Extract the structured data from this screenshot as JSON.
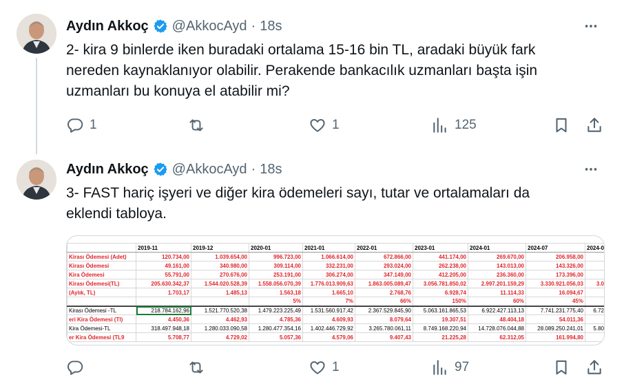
{
  "colors": {
    "text": "#0f1419",
    "secondary": "#536471",
    "verified": "#1d9bf0",
    "sheet_red": "#e0262c"
  },
  "tweets": [
    {
      "author": {
        "name": "Aydın Akkoç",
        "handle": "@AkkocAyd",
        "time": "18s"
      },
      "separator": "·",
      "text": "2- kira 9 binlerde iken buradaki ortalama 15-16 bin TL, aradaki büyük fark\nnereden kaynaklanıyor olabilir. Perakende bankacılık uzmanları başta işin\nuzmanları bu konuya el atabilir mi?",
      "replies": "1",
      "reposts": "",
      "likes": "1",
      "views": "125"
    },
    {
      "author": {
        "name": "Aydın Akkoç",
        "handle": "@AkkocAyd",
        "time": "18s"
      },
      "separator": "·",
      "text": "3- FAST hariç işyeri ve diğer kira ödemeleri sayı, tutar ve ortalamaları da\neklendi tabloya.",
      "replies": "",
      "reposts": "",
      "likes": "1",
      "views": "97"
    }
  ],
  "icons": {
    "reply": "reply-icon",
    "repost": "repost-icon",
    "like": "heart-icon",
    "views": "views-icon",
    "bookmark": "bookmark-icon",
    "share": "share-icon",
    "more": "more-icon",
    "verified": "verified-badge-icon"
  },
  "spreadsheet": {
    "header": [
      "",
      "2019-11",
      "2019-12",
      "2020-01",
      "2021-01",
      "2022-01",
      "2023-01",
      "2024-01",
      "2024-07",
      "2024-0"
    ],
    "rows": [
      [
        "Kirası Ödemesi (Adet)",
        "120.734,00",
        "1.039.654,00",
        "996.723,00",
        "1.066.614,00",
        "672.866,00",
        "441.174,00",
        "269.670,00",
        "206.958,00",
        ""
      ],
      [
        "Kirası Ödemesi",
        "49.161,00",
        "340.980,00",
        "309.114,00",
        "332.231,00",
        "293.024,00",
        "262.238,00",
        "143.013,00",
        "143.326,00",
        ""
      ],
      [
        "Kira Ödemesi",
        "55.791,00",
        "270.676,00",
        "253.191,00",
        "306.274,00",
        "347.149,00",
        "412.205,00",
        "236.360,00",
        "173.396,00",
        ""
      ],
      [
        "Kirası Ödemesi(TL)",
        "205.630.342,37",
        "1.544.020.528,39",
        "1.558.056.070,39",
        "1.776.013.909,63",
        "1.863.005.089,47",
        "3.056.781.850,02",
        "2.997.201.159,29",
        "3.330.921.056,03",
        "3.0"
      ],
      [
        "(Aylık, TL)",
        "1.703,17",
        "1.485,13",
        "1.563,18",
        "1.665,10",
        "2.768,76",
        "6.928,74",
        "11.114,33",
        "16.094,67",
        ""
      ],
      [
        "",
        "",
        "",
        "5%",
        "7%",
        "66%",
        "150%",
        "60%",
        "45%",
        ""
      ],
      [
        "Kirası Ödemesi -TL",
        "218.784.162,96",
        "1.521.770.520,38",
        "1.479.223.225,49",
        "1.531.560.917,42",
        "2.367.529.845,90",
        "5.063.161.865,53",
        "6.922.427.113,13",
        "7.741.231.775,40",
        "6.72"
      ],
      [
        "eri Kira Ödemesi (Tl)",
        "4.450,36",
        "4.462,93",
        "4.785,36",
        "4.609,93",
        "8.079,64",
        "19.307,51",
        "48.404,18",
        "54.011,36",
        ""
      ],
      [
        "Kira Ödemesi-TL",
        "318.497.948,18",
        "1.280.033.090,58",
        "1.280.477.354,16",
        "1.402.446.729,92",
        "3.265.780.061,11",
        "8.749.168.220,94",
        "14.728.076.044,88",
        "28.089.250.241,01",
        "5.80"
      ],
      [
        "er Kira Ödemesi (TL9",
        "5.708,77",
        "4.729,02",
        "5.057,36",
        "4.579,06",
        "9.407,43",
        "21.225,28",
        "62.312,05",
        "161.994,80",
        ""
      ]
    ]
  }
}
